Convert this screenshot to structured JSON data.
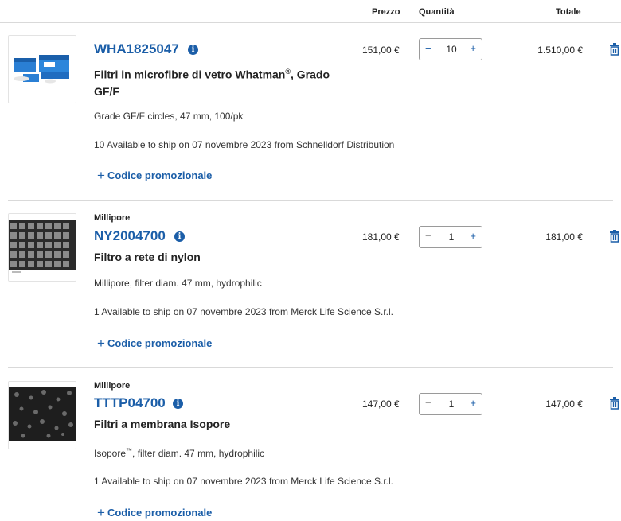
{
  "header": {
    "price": "Prezzo",
    "quantity": "Quantità",
    "total": "Totale"
  },
  "items": [
    {
      "brand": "",
      "sku": "WHA1825047",
      "title_main": "Filtri in microfibre di vetro Whatman",
      "title_sup": "®",
      "title_rest": ", Grado GF/F",
      "description": "Grade GF/F circles, 47 mm, 100/pk",
      "availability": "10 Available to ship on 07 novembre 2023 from Schnelldorf Distribution",
      "promo": "Codice promozionale",
      "price": "151,00 €",
      "quantity": "10",
      "total": "1.510,00 €",
      "image": "blue-filter-box-product-image"
    },
    {
      "brand": "Millipore",
      "sku": "NY2004700",
      "title_main": "Filtro a rete di nylon",
      "title_sup": "",
      "title_rest": "",
      "description": "Millipore, filter diam. 47 mm, hydrophilic",
      "availability": "1 Available to ship on 07 novembre 2023 from Merck Life Science S.r.l.",
      "promo": "Codice promozionale",
      "price": "181,00 €",
      "quantity": "1",
      "total": "181,00 €",
      "image": "nylon-mesh-micrograph"
    },
    {
      "brand": "Millipore",
      "sku": "TTTP04700",
      "title_main": "Filtri a membrana Isopore",
      "title_sup": "",
      "title_rest": "",
      "description_main": "Isopore",
      "description_sup": "™",
      "description_rest": ", filter diam. 47 mm, hydrophilic",
      "availability": "1 Available to ship on 07 novembre 2023 from Merck Life Science S.r.l.",
      "promo": "Codice promozionale",
      "price": "147,00 €",
      "quantity": "1",
      "total": "147,00 €",
      "image": "membrane-micrograph"
    }
  ],
  "icons": {
    "info": "info-icon",
    "trash": "trash-icon",
    "plus": "plus-icon",
    "minus": "minus-icon"
  },
  "colors": {
    "accent": "#1b5ea8",
    "divider": "#d9d9d9",
    "text": "#222222"
  }
}
